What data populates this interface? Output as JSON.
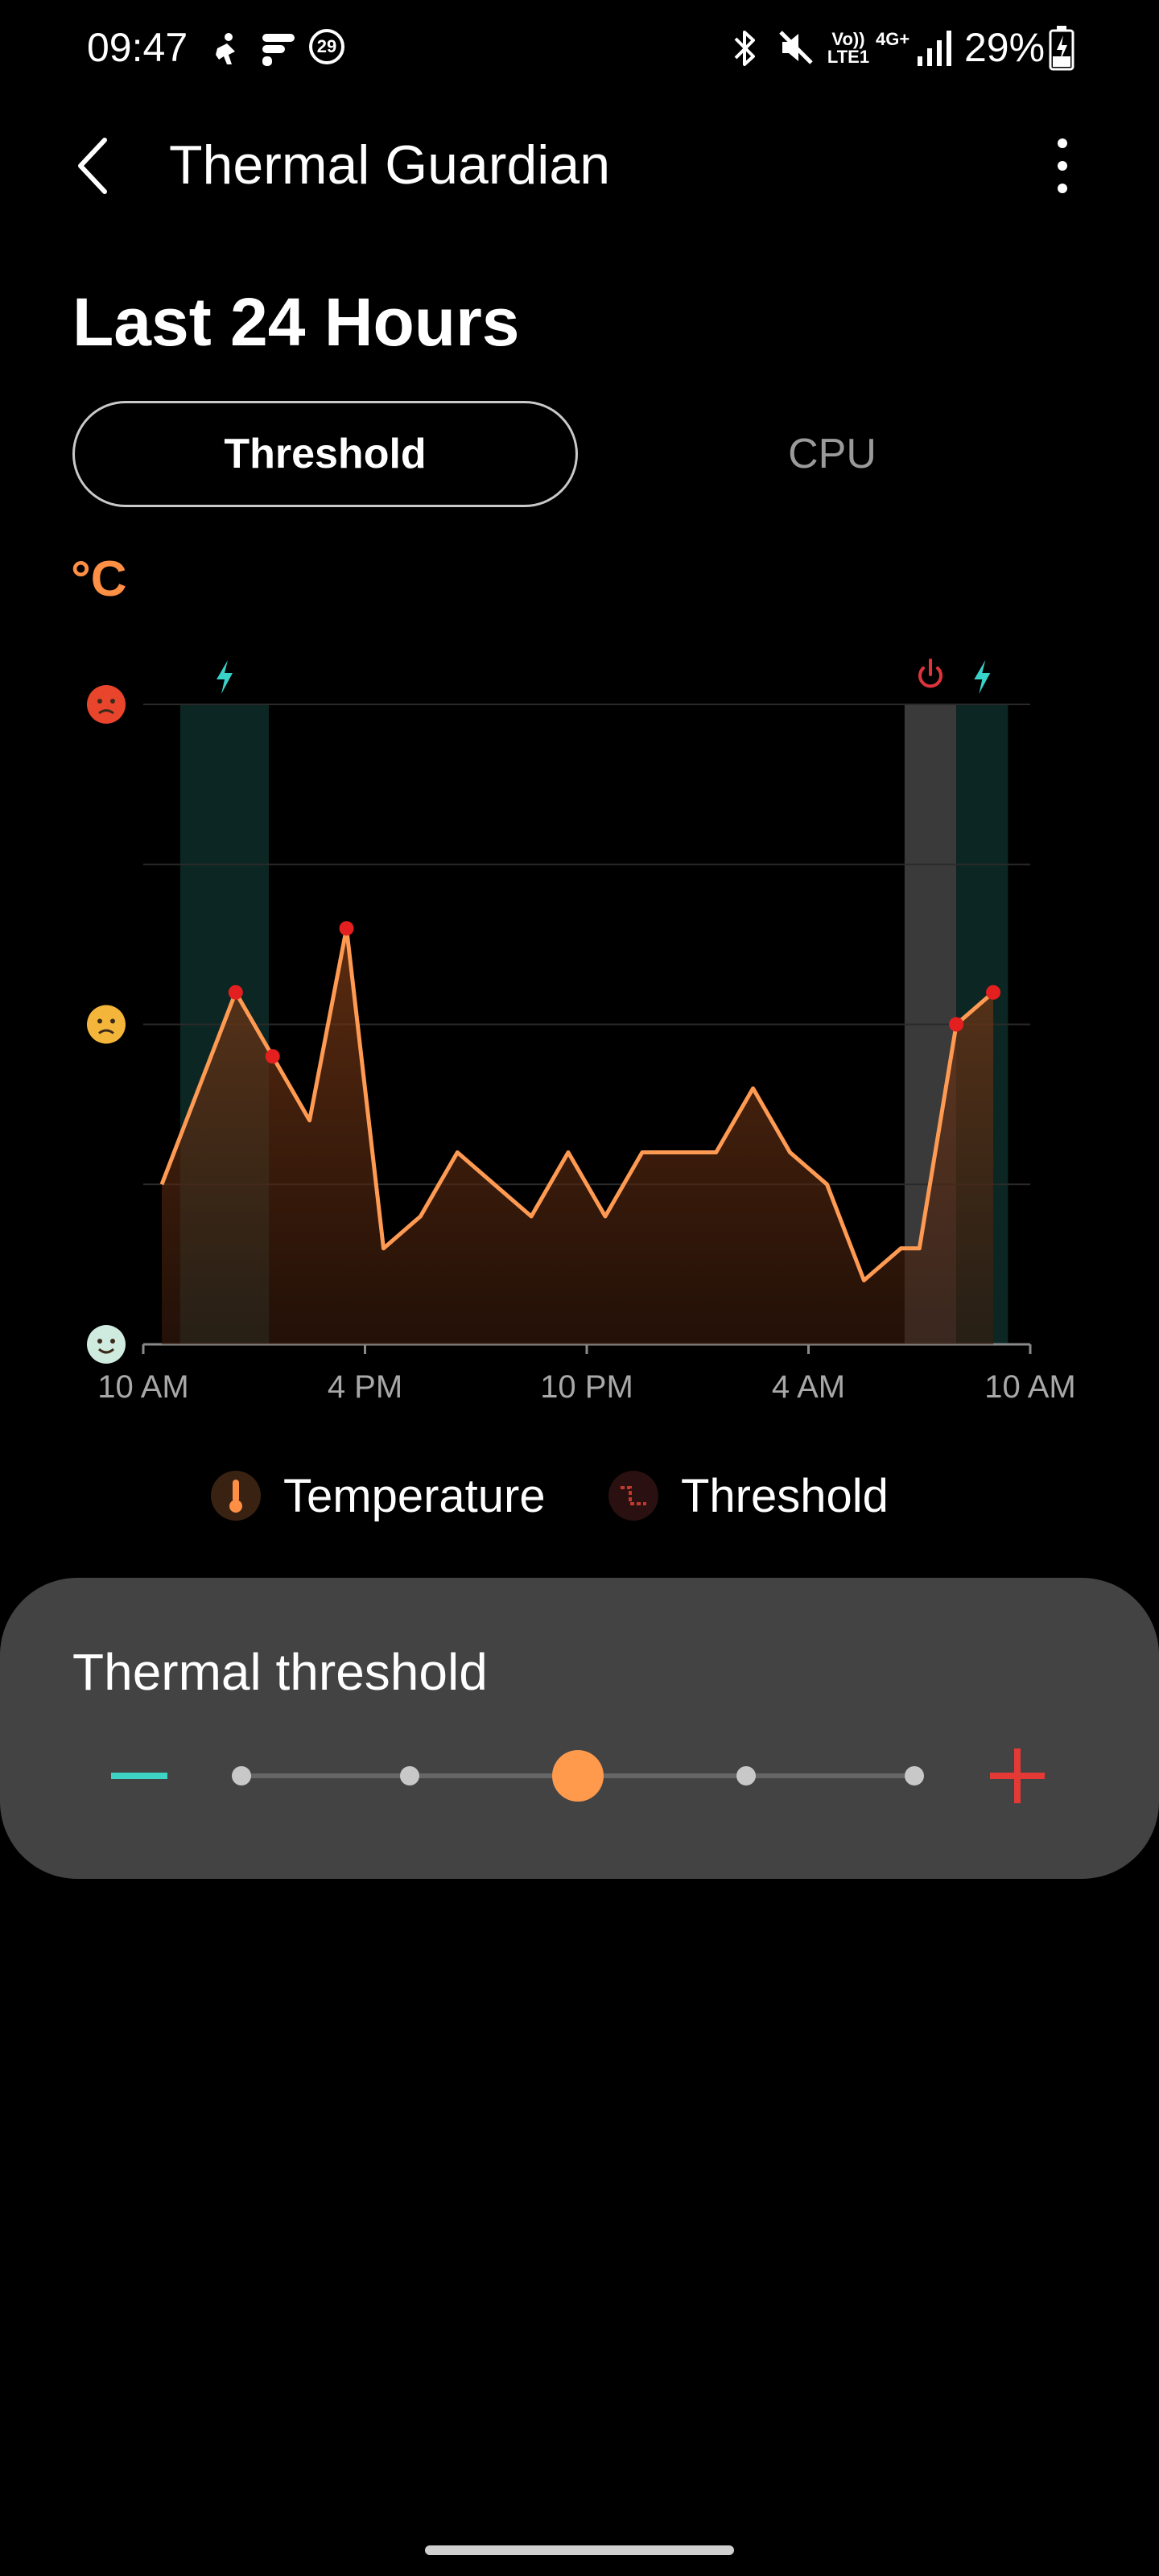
{
  "status_bar": {
    "time": "09:47",
    "notification_badge": "29",
    "lte_label": "Vo)) LTE1",
    "network_label": "4G+",
    "battery": "29%",
    "icons": [
      "fitness-icon",
      "flipboard-icon",
      "badge-29-icon",
      "bluetooth-icon",
      "mute-icon",
      "signal-icon",
      "battery-charging-icon"
    ]
  },
  "app_bar": {
    "title": "Thermal Guardian",
    "back_icon": "chevron-left-icon",
    "menu_icon": "more-vertical-icon"
  },
  "page": {
    "title": "Last 24 Hours"
  },
  "tabs": [
    {
      "label": "Threshold",
      "active": true
    },
    {
      "label": "CPU",
      "active": false
    }
  ],
  "chart_unit": "°C",
  "chart_data": {
    "type": "area",
    "title": "",
    "xlabel": "",
    "ylabel": "°C",
    "x_ticks": [
      "10 AM",
      "4 PM",
      "10 PM",
      "4 AM",
      "10 AM"
    ],
    "x_hours": [
      0,
      6,
      12,
      18,
      24
    ],
    "y_levels": [
      "hot",
      "warm",
      "cool"
    ],
    "y_level_icons": [
      "hot-face-icon",
      "worried-face-icon",
      "cool-face-icon"
    ],
    "ylim": [
      0,
      100
    ],
    "grid": true,
    "series": [
      {
        "name": "Temperature",
        "color": "#ff9a52",
        "x": [
          0.5,
          2.5,
          3.5,
          4.5,
          5.5,
          6.5,
          7.5,
          8.5,
          9.5,
          10.5,
          11.5,
          12.5,
          13.5,
          14.5,
          15.5,
          16.5,
          17.5,
          18.5,
          19.5,
          20.5,
          21.0,
          22.0,
          23.0
        ],
        "values": [
          25,
          55,
          45,
          35,
          65,
          15,
          20,
          30,
          25,
          20,
          30,
          20,
          30,
          30,
          30,
          40,
          30,
          25,
          10,
          15,
          15,
          50,
          55
        ]
      }
    ],
    "highlight_points": [
      {
        "x": 2.5,
        "value": 55
      },
      {
        "x": 3.5,
        "value": 45
      },
      {
        "x": 5.5,
        "value": 65
      },
      {
        "x": 22.0,
        "value": 50
      },
      {
        "x": 23.0,
        "value": 55
      }
    ],
    "bands": [
      {
        "type": "charging",
        "from": 1.0,
        "to": 3.4,
        "color": "#0b2623",
        "icon": "lightning-icon",
        "icon_color": "#39d2c8"
      },
      {
        "type": "power-off",
        "from": 20.6,
        "to": 22.0,
        "color": "#3a3a3b",
        "icon": "power-icon",
        "icon_color": "#e0343c"
      },
      {
        "type": "charging",
        "from": 22.0,
        "to": 23.4,
        "color": "#0b2623",
        "icon": "lightning-icon",
        "icon_color": "#39d2c8"
      }
    ]
  },
  "legend": [
    {
      "label": "Temperature",
      "icon": "thermometer-icon",
      "color": "#ff8f45"
    },
    {
      "label": "Threshold",
      "icon": "threshold-step-icon",
      "color": "#c0392b"
    }
  ],
  "threshold_card": {
    "title": "Thermal threshold",
    "minus_icon": "minus-icon",
    "plus_icon": "plus-icon",
    "minus_color": "#3ed3c4",
    "plus_color": "#e53935",
    "steps": 5,
    "selected_step": 3,
    "thumb_color": "#ff9a4d"
  }
}
